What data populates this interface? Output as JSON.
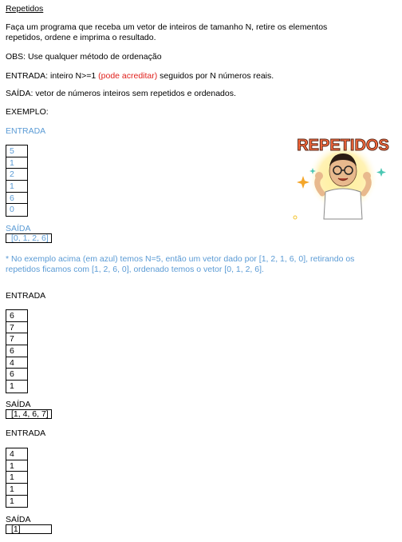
{
  "title": "Repetidos",
  "intro": "Faça um programa que receba um vetor de inteiros de tamanho N, retire os elementos repetidos, ordene e imprima o resultado.",
  "obs": "OBS: Use qualquer método de ordenação",
  "entrada": {
    "before": "ENTRADA: inteiro N>=1 ",
    "highlight": "(pode acreditar)",
    "after": " seguidos por N números reais."
  },
  "saida": "SAÍDA: vetor de números inteiros sem repetidos e ordenados.",
  "exemplo_label": "EXEMPLO:",
  "input_label": "ENTRADA",
  "output_label": "SAÍDA",
  "illustration_text": "REPETIDOS",
  "examples": [
    {
      "input": [
        "5",
        "1",
        "2",
        "1",
        "6",
        "0"
      ],
      "output": "[0, 1, 2, 6]"
    },
    {
      "input": [
        "6",
        "7",
        "7",
        "6",
        "4",
        "6",
        "1"
      ],
      "output": "[1, 4, 6, 7]"
    },
    {
      "input": [
        "4",
        "1",
        "1",
        "1",
        "1"
      ],
      "output": "[1]"
    }
  ],
  "note": "* No exemplo acima (em azul) temos N=5, então um vetor dado por [1, 2, 1, 6, 0], retirando os repetidos ficamos com [1, 2, 6, 0],  ordenado temos o vetor [0, 1, 2, 6]."
}
